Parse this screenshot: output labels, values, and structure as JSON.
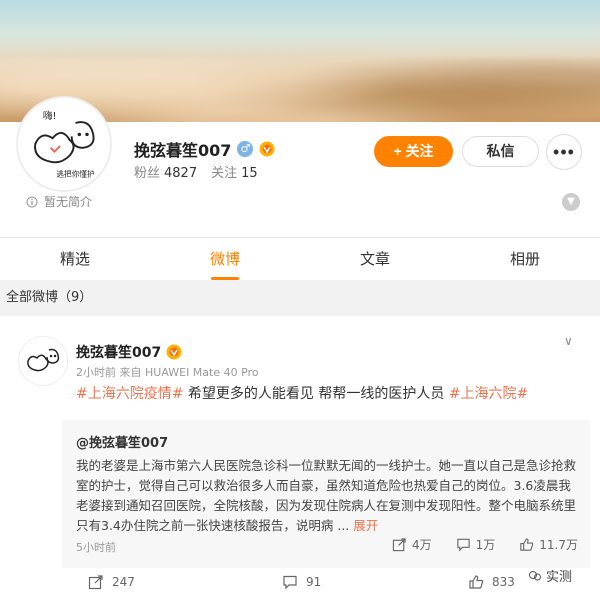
{
  "profile": {
    "username": "挽弦暮笙007",
    "gender_symbol": "♂",
    "followers_label": "粉丝",
    "followers_count": "4827",
    "following_label": "关注",
    "following_count": "15",
    "follow_button": "+ 关注",
    "message_button": "私信",
    "more_button": "•••",
    "bio": "暂无简介",
    "avatar_text_top": "嗨!",
    "avatar_text_bottom": "逃把你懂护"
  },
  "tabs": [
    {
      "label": "精选",
      "active": false
    },
    {
      "label": "微博",
      "active": true
    },
    {
      "label": "文章",
      "active": false
    },
    {
      "label": "相册",
      "active": false
    }
  ],
  "feed": {
    "section_title": "全部微博（9）"
  },
  "post": {
    "username": "挽弦暮笙007",
    "meta": "2小时前  来自 HUAWEI Mate 40 Pro",
    "hashtag1": "#上海六院疫情#",
    "body": " 希望更多的人能看见 帮帮一线的医护人员",
    "hashtag2": "#上海六院#",
    "repost": {
      "user": "@挽弦暮笙007",
      "text": "我的老婆是上海市第六人民医院急诊科一位默默无闻的一线护士。她一直以自己是急诊抢救室的护士，觉得自己可以救治很多人而自豪，虽然知道危险也热爱自己的岗位。3.6凌晨我老婆接到通知召回医院，全院核酸，因为发现住院病人在复测中发现阳性。整个电脑系统里只有3.4办住院之前一张快速核酸报告，说明病 ...",
      "expand": "展开",
      "time": "5小时前",
      "reposts": "4万",
      "comments": "1万",
      "likes": "11.7万"
    },
    "reposts": "247",
    "comments": "91",
    "likes": "833"
  },
  "watermark": "实测",
  "colors": {
    "accent": "#ff8200",
    "hashtag": "#eb7350",
    "section_bg": "#f2f2f2"
  }
}
